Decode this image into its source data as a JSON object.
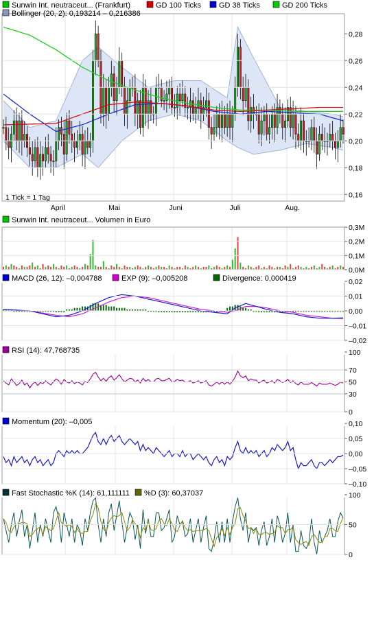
{
  "chart_data": [
    {
      "type": "candlestick",
      "panel": "price",
      "legend": [
        {
          "label": "Sunwin Int. neutraceut... (Frankfurt)",
          "color": "#00c000"
        },
        {
          "label": "GD 100 Ticks",
          "color": "#d00000"
        },
        {
          "label": "GD 38 Ticks",
          "color": "#0000cc"
        },
        {
          "label": "GD 200 Ticks",
          "color": "#00cc00"
        },
        {
          "label": "Bollinger (20, 2): 0,193214 – 0,216386",
          "color": "#8899bb"
        }
      ],
      "yticks": [
        "0,28",
        "0,26",
        "0,24",
        "0,22",
        "0,20",
        "0,18",
        "0,16"
      ],
      "ylim": [
        0.155,
        0.295
      ],
      "x_labels": [
        "April",
        "Mai",
        "Juni",
        "Juli",
        "Aug."
      ],
      "x_label_index": [
        20,
        42,
        65,
        88,
        109
      ],
      "note": "1 Tick = 1 Tag",
      "n": 130,
      "close": [
        0.21,
        0.2,
        0.195,
        0.205,
        0.215,
        0.2,
        0.215,
        0.2,
        0.205,
        0.195,
        0.19,
        0.185,
        0.195,
        0.18,
        0.19,
        0.185,
        0.195,
        0.19,
        0.185,
        0.185,
        0.2,
        0.21,
        0.205,
        0.19,
        0.215,
        0.205,
        0.2,
        0.195,
        0.2,
        0.205,
        0.19,
        0.2,
        0.195,
        0.2,
        0.26,
        0.28,
        0.26,
        0.22,
        0.24,
        0.22,
        0.24,
        0.25,
        0.23,
        0.24,
        0.26,
        0.24,
        0.22,
        0.23,
        0.24,
        0.24,
        0.22,
        0.23,
        0.21,
        0.24,
        0.22,
        0.23,
        0.22,
        0.22,
        0.24,
        0.24,
        0.23,
        0.23,
        0.235,
        0.24,
        0.225,
        0.225,
        0.235,
        0.23,
        0.235,
        0.225,
        0.225,
        0.23,
        0.22,
        0.225,
        0.23,
        0.22,
        0.225,
        0.23,
        0.21,
        0.205,
        0.21,
        0.22,
        0.21,
        0.22,
        0.21,
        0.22,
        0.21,
        0.22,
        0.24,
        0.27,
        0.24,
        0.23,
        0.24,
        0.215,
        0.225,
        0.22,
        0.22,
        0.205,
        0.215,
        0.22,
        0.205,
        0.21,
        0.22,
        0.21,
        0.225,
        0.22,
        0.21,
        0.215,
        0.225,
        0.21,
        0.22,
        0.205,
        0.2,
        0.215,
        0.2,
        0.2,
        0.2,
        0.21,
        0.2,
        0.19,
        0.205,
        0.2,
        0.2,
        0.2,
        0.205,
        0.2,
        0.195,
        0.2,
        0.21,
        0.205
      ],
      "gd100": {
        "x": [
          0,
          20,
          30,
          40,
          50,
          60,
          70,
          80,
          90,
          100,
          110,
          120,
          129
        ],
        "y": [
          0.212,
          0.213,
          0.22,
          0.227,
          0.229,
          0.228,
          0.226,
          0.223,
          0.222,
          0.223,
          0.224,
          0.225,
          0.225
        ]
      },
      "gd38": {
        "x": [
          0,
          10,
          20,
          30,
          40,
          50,
          60,
          70,
          80,
          90,
          100,
          110,
          120,
          129
        ],
        "y": [
          0.235,
          0.22,
          0.207,
          0.212,
          0.22,
          0.227,
          0.228,
          0.226,
          0.222,
          0.22,
          0.222,
          0.221,
          0.22,
          0.215
        ]
      },
      "gd200": {
        "x": [
          0,
          10,
          20,
          30,
          40,
          50,
          60,
          70,
          80,
          90,
          100,
          110,
          120,
          129
        ],
        "y": [
          0.285,
          0.279,
          0.268,
          0.255,
          0.245,
          0.238,
          0.232,
          0.228,
          0.225,
          0.223,
          0.223,
          0.222,
          0.222,
          0.222
        ]
      },
      "boll_upper": {
        "x": [
          0,
          10,
          20,
          30,
          36,
          45,
          55,
          65,
          75,
          85,
          89,
          95,
          105,
          115,
          125,
          129
        ],
        "y": [
          0.23,
          0.21,
          0.215,
          0.26,
          0.27,
          0.255,
          0.24,
          0.245,
          0.245,
          0.232,
          0.285,
          0.262,
          0.225,
          0.222,
          0.22,
          0.218
        ]
      },
      "boll_lower": {
        "x": [
          0,
          10,
          20,
          30,
          36,
          45,
          55,
          65,
          75,
          85,
          89,
          95,
          105,
          115,
          125,
          129
        ],
        "y": [
          0.2,
          0.18,
          0.18,
          0.19,
          0.18,
          0.2,
          0.215,
          0.22,
          0.215,
          0.2,
          0.195,
          0.19,
          0.193,
          0.198,
          0.195,
          0.193
        ]
      }
    },
    {
      "type": "bar",
      "panel": "volume",
      "legend": [
        {
          "label": "Sunwin Int. neutraceut... Volumen in Euro",
          "color": "#00c000"
        }
      ],
      "yticks": [
        "0,3M",
        "0,2M",
        "0,1M",
        "0,0M"
      ],
      "ylim": [
        0,
        0.3
      ],
      "n": 130,
      "values": [
        0.02,
        0.03,
        0.02,
        0.04,
        0.03,
        0.02,
        0.01,
        0.03,
        0.02,
        0.02,
        0.03,
        0.05,
        0.02,
        0.03,
        0.01,
        0.04,
        0.02,
        0.03,
        0.02,
        0.04,
        0.02,
        0.01,
        0.03,
        0.02,
        0.03,
        0.01,
        0.02,
        0.03,
        0.02,
        0.01,
        0.02,
        0.04,
        0.03,
        0.11,
        0.21,
        0.03,
        0.02,
        0.02,
        0.06,
        0.02,
        0.01,
        0.03,
        0.02,
        0.04,
        0.02,
        0.01,
        0.03,
        0.02,
        0.02,
        0.01,
        0.02,
        0.03,
        0.02,
        0.01,
        0.02,
        0.03,
        0.02,
        0.01,
        0.02,
        0.03,
        0.02,
        0.02,
        0.01,
        0.03,
        0.02,
        0.01,
        0.02,
        0.02,
        0.01,
        0.03,
        0.02,
        0.01,
        0.02,
        0.03,
        0.02,
        0.01,
        0.02,
        0.02,
        0.03,
        0.01,
        0.02,
        0.03,
        0.02,
        0.01,
        0.02,
        0.03,
        0.02,
        0.07,
        0.15,
        0.23,
        0.05,
        0.02,
        0.01,
        0.03,
        0.02,
        0.01,
        0.02,
        0.03,
        0.01,
        0.02,
        0.01,
        0.03,
        0.02,
        0.01,
        0.02,
        0.02,
        0.01,
        0.03,
        0.02,
        0.04,
        0.01,
        0.02,
        0.03,
        0.02,
        0.01,
        0.02,
        0.01,
        0.02,
        0.03,
        0.01,
        0.02,
        0.04,
        0.02,
        0.01,
        0.02,
        0.03,
        0.01,
        0.02,
        0.03,
        0.02
      ],
      "colors": [
        "r",
        "g",
        "r",
        "g",
        "r",
        "r",
        "g",
        "r",
        "g",
        "r",
        "r",
        "g",
        "r",
        "g",
        "r",
        "r",
        "g",
        "r",
        "r",
        "g",
        "r",
        "g",
        "r",
        "r",
        "g",
        "r",
        "g",
        "r",
        "r",
        "g",
        "r",
        "g",
        "r",
        "g",
        "g",
        "g",
        "r",
        "r",
        "g",
        "r",
        "g",
        "r",
        "r",
        "g",
        "r",
        "g",
        "r",
        "r",
        "g",
        "r",
        "g",
        "r",
        "r",
        "g",
        "r",
        "g",
        "r",
        "r",
        "g",
        "r",
        "g",
        "r",
        "r",
        "g",
        "r",
        "g",
        "r",
        "r",
        "g",
        "r",
        "g",
        "r",
        "r",
        "g",
        "r",
        "g",
        "r",
        "r",
        "g",
        "r",
        "g",
        "r",
        "r",
        "g",
        "r",
        "g",
        "r",
        "g",
        "g",
        "r",
        "g",
        "r",
        "r",
        "g",
        "r",
        "g",
        "r",
        "r",
        "g",
        "r",
        "g",
        "r",
        "r",
        "g",
        "r",
        "g",
        "r",
        "r",
        "g",
        "r",
        "g",
        "r",
        "r",
        "g",
        "r",
        "g",
        "r",
        "r",
        "g",
        "r",
        "g",
        "r",
        "r",
        "g",
        "r",
        "g",
        "r",
        "r",
        "g",
        "r"
      ]
    },
    {
      "type": "line",
      "panel": "macd",
      "legend": [
        {
          "label": "MACD (26, 12): –0,004788",
          "color": "#0000cc"
        },
        {
          "label": "EXP (9): –0,005208",
          "color": "#cc00cc"
        },
        {
          "label": "Divergence: 0,000419",
          "color": "#006600"
        }
      ],
      "yticks": [
        "0,02",
        "0,01",
        "0,00",
        "–0,01",
        "–0,02"
      ],
      "ylim": [
        -0.02,
        0.02
      ],
      "n": 130,
      "macd": {
        "x": [
          0,
          10,
          20,
          25,
          30,
          35,
          40,
          45,
          50,
          55,
          60,
          65,
          70,
          75,
          80,
          85,
          88,
          92,
          96,
          100,
          105,
          110,
          115,
          120,
          125,
          129
        ],
        "y": [
          0.001,
          0.0,
          -0.004,
          -0.003,
          0.0,
          0.005,
          0.009,
          0.011,
          0.01,
          0.008,
          0.006,
          0.004,
          0.002,
          0.0,
          -0.001,
          -0.002,
          0.002,
          0.005,
          0.003,
          0.001,
          -0.001,
          -0.002,
          -0.004,
          -0.005,
          -0.005,
          -0.0048
        ]
      },
      "exp": {
        "x": [
          0,
          10,
          20,
          25,
          30,
          35,
          40,
          45,
          50,
          55,
          60,
          65,
          70,
          75,
          80,
          85,
          88,
          92,
          96,
          100,
          105,
          110,
          115,
          120,
          125,
          129
        ],
        "y": [
          0.0,
          0.0,
          -0.003,
          -0.004,
          -0.002,
          0.002,
          0.006,
          0.009,
          0.01,
          0.009,
          0.007,
          0.005,
          0.003,
          0.001,
          0.0,
          -0.001,
          0.0,
          0.003,
          0.003,
          0.002,
          0.0,
          -0.001,
          -0.003,
          -0.004,
          -0.005,
          -0.0052
        ]
      },
      "divergence_hist": [
        0.001,
        0.001,
        0.001,
        0.001,
        0.0,
        0.0,
        0.0,
        0.0,
        0.0,
        0.0,
        0.0,
        0.0,
        0.0,
        0.0,
        0.0,
        0.0,
        0.0,
        0.0,
        0.0,
        0.0,
        -0.001,
        -0.001,
        -0.001,
        -0.001,
        0.001,
        0.001,
        0.001,
        0.002,
        0.002,
        0.002,
        0.003,
        0.003,
        0.003,
        0.004,
        0.005,
        0.005,
        0.005,
        0.004,
        0.004,
        0.004,
        0.003,
        0.003,
        0.003,
        0.002,
        0.002,
        0.002,
        0.002,
        0.001,
        0.001,
        0.001,
        0.001,
        0.001,
        0.001,
        0.001,
        0.001,
        0.0,
        0.0,
        0.0,
        0.0,
        -0.001,
        -0.001,
        -0.001,
        -0.001,
        -0.001,
        -0.001,
        -0.001,
        -0.001,
        -0.001,
        -0.001,
        -0.001,
        -0.001,
        -0.001,
        -0.001,
        -0.001,
        -0.001,
        -0.001,
        -0.001,
        -0.001,
        -0.001,
        -0.001,
        -0.001,
        -0.001,
        0.0,
        0.0,
        0.0,
        0.002,
        0.003,
        0.003,
        0.004,
        0.004,
        0.003,
        0.002,
        0.002,
        0.001,
        0.001,
        0.0,
        0.0,
        -0.001,
        -0.001,
        -0.001,
        -0.001,
        -0.001,
        -0.001,
        -0.001,
        -0.001,
        -0.001,
        -0.001,
        -0.001,
        -0.001,
        0.0,
        0.0,
        0.0,
        0.0,
        0.0,
        0.0,
        0.0,
        0.0,
        0.0,
        0.0,
        0.0,
        0.0,
        0.0,
        0.0,
        0.0,
        0.0,
        0.0,
        0.0,
        0.0,
        0.0,
        0.0
      ]
    },
    {
      "type": "line",
      "panel": "rsi",
      "legend": [
        {
          "label": "RSI (14): 47,768735",
          "color": "#990099"
        }
      ],
      "yticks": [
        "100",
        "70",
        "50",
        "30",
        "0"
      ],
      "ylim": [
        0,
        100
      ],
      "lines": [
        70,
        30
      ],
      "n": 130,
      "y": [
        52,
        48,
        45,
        55,
        50,
        44,
        47,
        53,
        45,
        48,
        40,
        46,
        50,
        44,
        49,
        47,
        52,
        48,
        45,
        50,
        55,
        52,
        46,
        54,
        50,
        48,
        52,
        47,
        50,
        48,
        45,
        51,
        49,
        55,
        63,
        66,
        58,
        52,
        56,
        51,
        57,
        60,
        53,
        57,
        62,
        55,
        50,
        53,
        56,
        55,
        50,
        53,
        48,
        56,
        51,
        54,
        50,
        50,
        55,
        56,
        52,
        52,
        54,
        56,
        50,
        51,
        54,
        52,
        53,
        50,
        50,
        52,
        48,
        50,
        52,
        48,
        50,
        52,
        45,
        43,
        46,
        50,
        46,
        50,
        46,
        50,
        46,
        51,
        58,
        68,
        60,
        57,
        60,
        52,
        55,
        53,
        53,
        48,
        51,
        53,
        48,
        50,
        52,
        48,
        54,
        52,
        49,
        51,
        54,
        49,
        52,
        47,
        45,
        50,
        46,
        46,
        46,
        49,
        46,
        43,
        48,
        46,
        46,
        46,
        48,
        46,
        44,
        46,
        50,
        48
      ]
    },
    {
      "type": "line",
      "panel": "momentum",
      "legend": [
        {
          "label": "Momentum (20): –0,005",
          "color": "#0000cc"
        }
      ],
      "yticks": [
        "0,10",
        "0,05",
        "0,00",
        "–0,05",
        "–0,10"
      ],
      "ylim": [
        -0.1,
        0.1
      ],
      "n": 130,
      "y": [
        -0.01,
        -0.03,
        -0.02,
        -0.04,
        -0.01,
        -0.03,
        -0.02,
        -0.01,
        -0.03,
        -0.02,
        -0.04,
        -0.02,
        -0.01,
        -0.03,
        -0.02,
        -0.04,
        -0.03,
        -0.02,
        -0.04,
        -0.03,
        0.0,
        0.01,
        0.0,
        -0.01,
        0.01,
        0.0,
        0.01,
        0.0,
        0.01,
        0.0,
        0.0,
        0.01,
        0.02,
        0.04,
        0.06,
        0.07,
        0.04,
        0.03,
        0.05,
        0.03,
        0.05,
        0.06,
        0.04,
        0.05,
        0.06,
        0.04,
        0.03,
        0.04,
        0.05,
        0.04,
        0.03,
        0.04,
        0.01,
        0.03,
        0.01,
        0.02,
        0.01,
        0.0,
        0.02,
        0.01,
        0.0,
        -0.01,
        0.0,
        0.01,
        -0.01,
        0.0,
        0.0,
        -0.01,
        0.01,
        -0.01,
        0.0,
        0.0,
        -0.02,
        -0.01,
        0.0,
        -0.01,
        -0.02,
        -0.01,
        -0.03,
        -0.04,
        -0.02,
        -0.01,
        -0.03,
        -0.02,
        -0.04,
        -0.01,
        -0.02,
        -0.01,
        0.02,
        0.04,
        0.01,
        0.0,
        0.02,
        0.0,
        0.01,
        0.0,
        0.01,
        -0.01,
        0.0,
        0.01,
        -0.01,
        0.0,
        0.02,
        0.01,
        0.03,
        0.02,
        0.01,
        0.02,
        0.04,
        0.01,
        0.02,
        -0.02,
        -0.05,
        -0.03,
        -0.04,
        -0.04,
        -0.03,
        -0.02,
        -0.04,
        -0.05,
        -0.03,
        -0.03,
        -0.04,
        -0.03,
        -0.02,
        -0.03,
        -0.02,
        -0.01,
        -0.01,
        -0.005
      ]
    },
    {
      "type": "line",
      "panel": "stochastic",
      "legend": [
        {
          "label": "Fast Stochastic %K (14): 61,111111",
          "color": "#003333"
        },
        {
          "label": "%D (3): 60,37037",
          "color": "#666600"
        }
      ],
      "yticks": [
        "100",
        "50",
        "0"
      ],
      "ylim": [
        0,
        100
      ],
      "n": 130,
      "k": [
        60,
        40,
        20,
        50,
        70,
        30,
        55,
        75,
        30,
        50,
        10,
        40,
        70,
        20,
        50,
        30,
        60,
        40,
        20,
        70,
        80,
        60,
        20,
        70,
        50,
        30,
        60,
        20,
        50,
        40,
        15,
        60,
        40,
        70,
        90,
        95,
        50,
        20,
        60,
        30,
        70,
        85,
        40,
        65,
        90,
        55,
        20,
        45,
        70,
        60,
        25,
        50,
        10,
        75,
        35,
        60,
        30,
        30,
        70,
        70,
        40,
        45,
        60,
        75,
        20,
        30,
        65,
        50,
        55,
        30,
        35,
        60,
        20,
        40,
        60,
        20,
        45,
        65,
        10,
        5,
        25,
        55,
        20,
        55,
        20,
        60,
        20,
        55,
        80,
        95,
        60,
        40,
        70,
        20,
        45,
        40,
        45,
        15,
        40,
        55,
        15,
        30,
        60,
        20,
        65,
        50,
        20,
        35,
        70,
        20,
        50,
        5,
        5,
        40,
        15,
        10,
        20,
        60,
        20,
        0,
        40,
        20,
        30,
        40,
        60,
        30,
        30,
        55,
        70,
        61
      ]
    }
  ]
}
